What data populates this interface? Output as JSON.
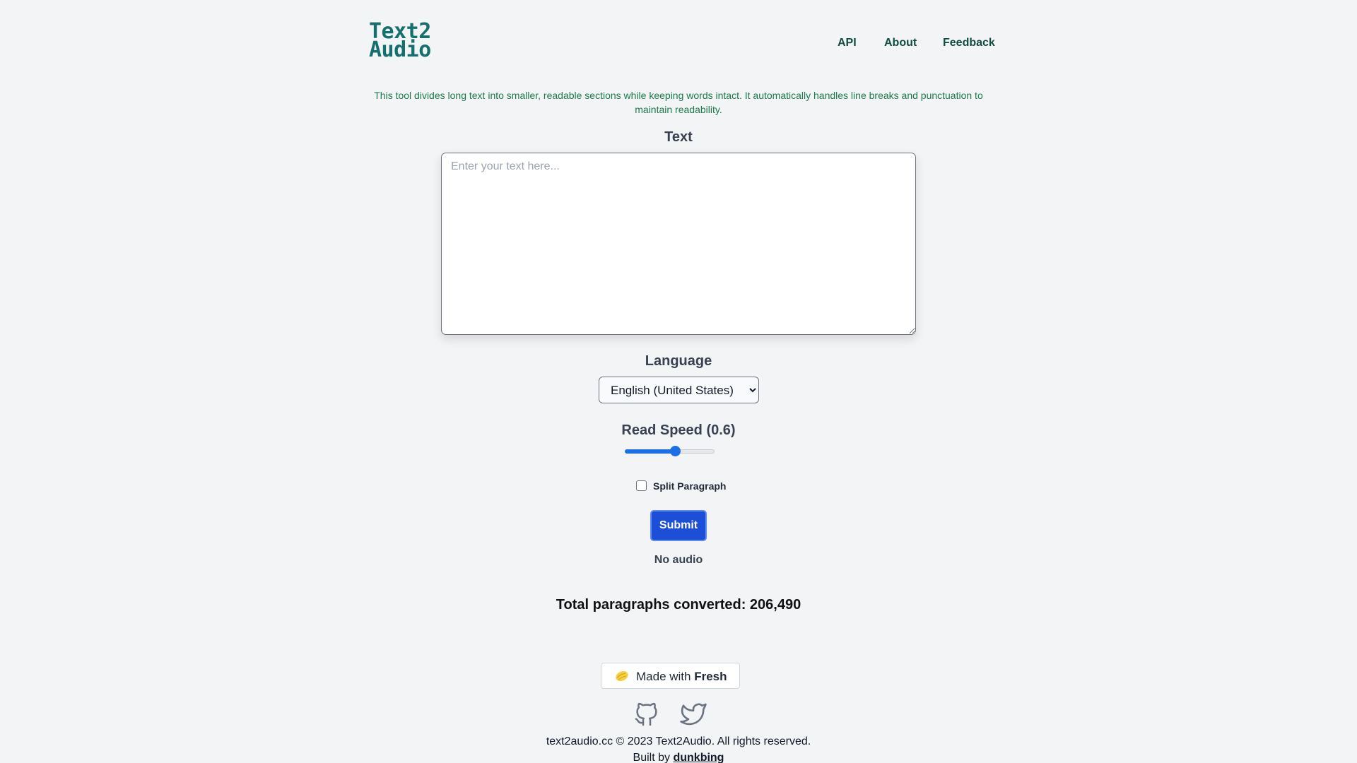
{
  "header": {
    "logo_line1": "Text2",
    "logo_line2": "Audio",
    "nav": {
      "api": "API",
      "about": "About",
      "feedback": "Feedback"
    }
  },
  "intro": "This tool divides long text into smaller, readable sections while keeping words intact. It automatically handles line breaks and punctuation to maintain readability.",
  "form": {
    "text_label": "Text",
    "text_placeholder": "Enter your text here...",
    "language_label": "Language",
    "language_selected": "English (United States)",
    "speed_label": "Read Speed (0.6)",
    "speed_value": 0.6,
    "speed_min": 0.1,
    "speed_max": 1,
    "split_label": "Split Paragraph",
    "split_checked": false,
    "submit_label": "Submit"
  },
  "status": "No audio",
  "total": "Total paragraphs converted: 206,490",
  "footer": {
    "made_with": "Made with",
    "fresh": "Fresh",
    "copyright": "text2audio.cc © 2023 Text2Audio. All rights reserved.",
    "built_by": "Built by",
    "author": "dunkbing",
    "icons": [
      "github-icon",
      "twitter-icon"
    ]
  },
  "colors": {
    "background": "#f3f4f6",
    "logo": "#14706d",
    "nav": "#0f4d3f",
    "intro": "#1a7a4c",
    "accent": "#1d6fe8",
    "submit": "#1d4ed8"
  }
}
